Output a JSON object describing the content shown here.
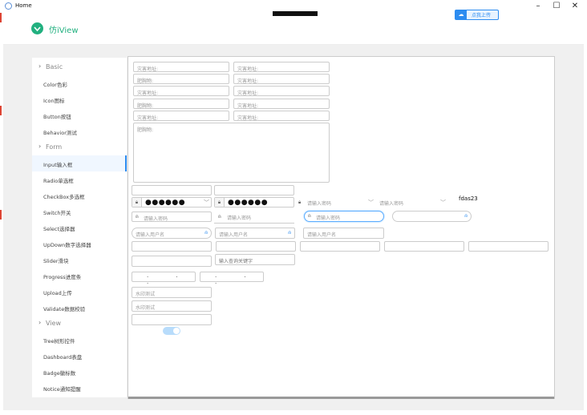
{
  "window": {
    "title": "Home",
    "min": "–",
    "max": "☐",
    "close": "✕"
  },
  "header": {
    "logo_text": "仿iView",
    "upload_label": "点我上传"
  },
  "sidebar": {
    "groups": [
      {
        "label": "Basic",
        "items": [
          "Color色彩",
          "Icon图标",
          "Button按钮",
          "Behavior测试"
        ]
      },
      {
        "label": "Form",
        "items": [
          "Input输入框",
          "Radio单选框",
          "CheckBox多选框",
          "Switch开关",
          "Select选择器",
          "UpDown数字选择器",
          "Slider滑块",
          "Progress进度条",
          "Upload上传",
          "Validate数据校验"
        ]
      },
      {
        "label": "View",
        "items": [
          "Tree树形控件",
          "Dashboard表盘",
          "Badge徽标数",
          "Notice通知提醒"
        ]
      }
    ],
    "active": "Input输入框"
  },
  "form": {
    "grid": [
      [
        "灾害地址:",
        "灾害地址:"
      ],
      [
        "肥胸物:",
        "灾害地址:"
      ],
      [
        "灾害地址:",
        "灾害地址:"
      ],
      [
        "肥胸物:",
        "灾害地址:"
      ],
      [
        "灾害地址:",
        "灾害地址:"
      ]
    ],
    "textarea_placeholder": "肥胸物:",
    "password_mask": "●●●●●●",
    "pwd_placeholder": "请输入密码",
    "user_placeholder": "请输入用户名",
    "search_placeholder": "输入查询关键字",
    "fdas_text": "fdas23",
    "watermark_1": "水印测试",
    "watermark_2": "水印测试",
    "date_dots": "· · ·"
  },
  "icons": {
    "lock": "lock-icon",
    "user": "user-icon",
    "chevron": "chevron-down-icon",
    "cloud": "cloud-upload-icon"
  }
}
